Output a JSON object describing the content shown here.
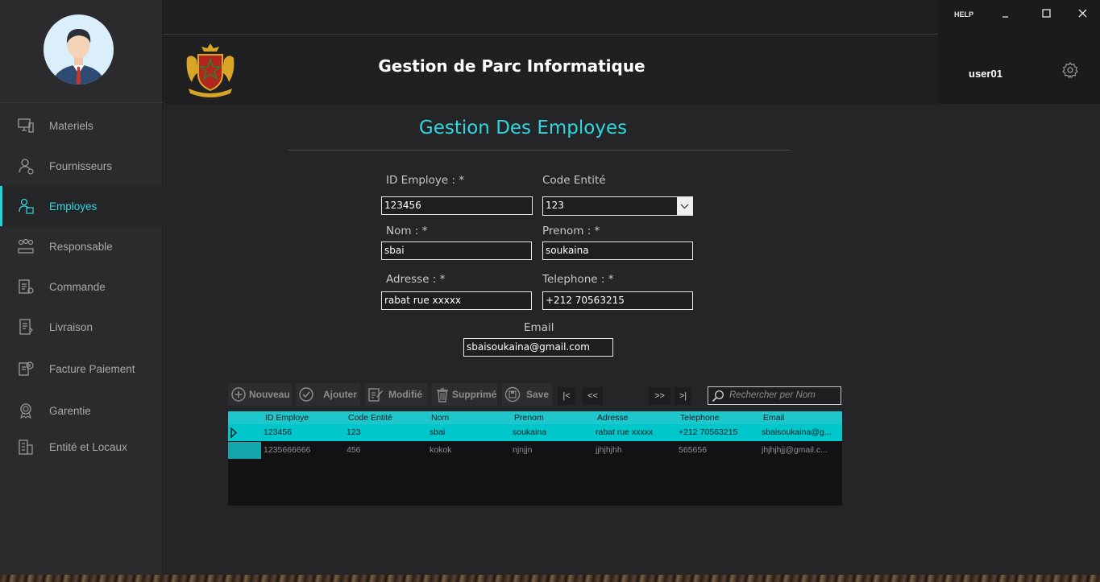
{
  "window": {
    "help": "HELP"
  },
  "header": {
    "app_title": "Gestion de Parc Informatique"
  },
  "user": {
    "name": "user01"
  },
  "sidebar": {
    "items": [
      {
        "label": "Materiels",
        "icon": "hardware-icon"
      },
      {
        "label": "Fournisseurs",
        "icon": "supplier-icon"
      },
      {
        "label": "Employes",
        "icon": "employee-icon",
        "active": true
      },
      {
        "label": "Responsable",
        "icon": "manager-icon"
      },
      {
        "label": "Commande",
        "icon": "order-icon"
      },
      {
        "label": "Livraison",
        "icon": "delivery-icon"
      },
      {
        "label": "Facture Paiement",
        "icon": "invoice-icon"
      },
      {
        "label": "Garentie",
        "icon": "warranty-icon"
      },
      {
        "label": "Entité et Locaux",
        "icon": "building-icon"
      }
    ]
  },
  "page": {
    "title": "Gestion Des Employes"
  },
  "form": {
    "id_label": "ID Employe : *",
    "id_value": "123456",
    "code_label": "Code Entité",
    "code_value": "123",
    "nom_label": "Nom : *",
    "nom_value": "sbai",
    "prenom_label": "Prenom : *",
    "prenom_value": "soukaina",
    "adresse_label": "Adresse : *",
    "adresse_value": "rabat rue xxxxx",
    "telephone_label": "Telephone : *",
    "telephone_value": "+212 70563215",
    "email_label": "Email",
    "email_value": "sbaisoukaina@gmail.com"
  },
  "toolbar": {
    "nouveau": "Nouveau",
    "ajouter": "Ajouter",
    "modifie": "Modifié",
    "supprime": "Supprimé",
    "save": "Save",
    "first": "|<",
    "prev": "<<",
    "next": ">>",
    "last": ">|",
    "search_placeholder": "Rechercher per Nom"
  },
  "table": {
    "columns": [
      "ID Employe",
      "Code Entité",
      "Nom",
      "Prenom",
      "Adresse",
      "Telephone",
      "Email"
    ],
    "rows": [
      [
        "123456",
        "123",
        "sbai",
        "soukaina",
        "rabat rue xxxxx",
        "+212 70563215",
        "sbaisoukaina@g..."
      ],
      [
        "1235666666",
        "456",
        "kokok",
        "njnjjn",
        "jjhjhjhh",
        "565656",
        "jhjhjhjj@gmail.c..."
      ]
    ],
    "selected_row": 0
  },
  "colors": {
    "accent": "#2fd7e0",
    "grid_header": "#1ec7cc",
    "selected_row": "#00c7cc"
  }
}
